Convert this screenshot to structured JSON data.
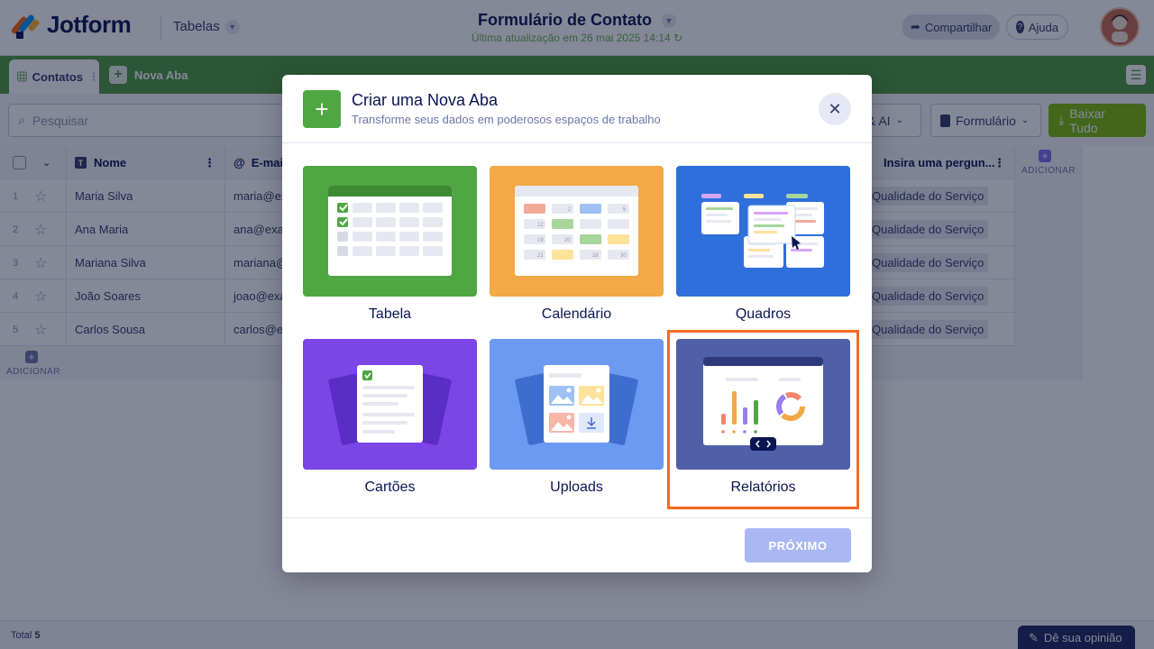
{
  "header": {
    "logo_text": "Jotform",
    "tables_menu": "Tabelas",
    "form_title": "Formulário de Contato",
    "last_update": "Última atualização em 26 mai 2025 14:14",
    "share_label": "Compartilhar",
    "help_label": "Ajuda"
  },
  "tabs": {
    "active_tab": "Contatos",
    "new_tab": "Nova Aba"
  },
  "toolbar": {
    "search_placeholder": "Pesquisar",
    "ai_label": "s & AI",
    "form_label": "Formulário",
    "download_label": "Baixar Tudo"
  },
  "table": {
    "columns": [
      "Nome",
      "E-mail",
      "Insira uma pergun..."
    ],
    "add_column_label": "ADICIONAR",
    "add_row_label": "ADICIONAR",
    "rows": [
      {
        "num": "1",
        "name": "Maria Silva",
        "email": "maria@exa",
        "answer": "Qualidade do Serviço"
      },
      {
        "num": "2",
        "name": "Ana Maria",
        "email": "ana@exam",
        "answer": "Qualidade do Serviço"
      },
      {
        "num": "3",
        "name": "Mariana Silva",
        "email": "mariana@",
        "answer": "Qualidade do Serviço"
      },
      {
        "num": "4",
        "name": "João Soares",
        "email": "joao@exar",
        "answer": "Qualidade do Serviço"
      },
      {
        "num": "5",
        "name": "Carlos Sousa",
        "email": "carlos@ex",
        "answer": "Qualidade do Serviço"
      }
    ]
  },
  "footer": {
    "total_label": "Total",
    "total_value": "5",
    "feedback_label": "Dê sua opinião"
  },
  "modal": {
    "title": "Criar uma Nova Aba",
    "subtitle": "Transforme seus dados em poderosos espaços de trabalho",
    "options": [
      {
        "label": "Tabela",
        "color": "#4fa743"
      },
      {
        "label": "Calendário",
        "color": "#f2a946"
      },
      {
        "label": "Quadros",
        "color": "#2f6fdc"
      },
      {
        "label": "Cartões",
        "color": "#7c45e8"
      },
      {
        "label": "Uploads",
        "color": "#6b9af0"
      },
      {
        "label": "Relatórios",
        "color": "#4f5fa8"
      }
    ],
    "selected": "Relatórios",
    "next_label": "PRÓXIMO",
    "calendar_numbers": [
      "2",
      "5",
      "12",
      "19",
      "20",
      "21",
      "28",
      "30"
    ]
  },
  "colors": {
    "brand_green": "#4c9b3c",
    "highlight": "#f26a21",
    "next_button": "#a9b8f3"
  }
}
